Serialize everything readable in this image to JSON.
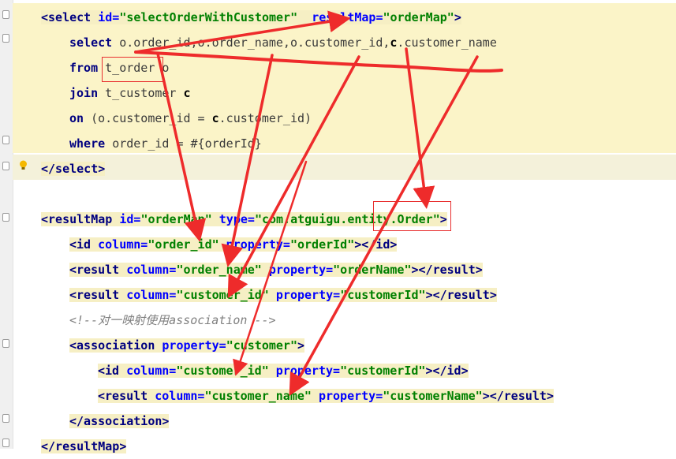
{
  "editor": {
    "line1": {
      "tag_open": "<select ",
      "attr1": "id=",
      "val1": "\"selectOrderWithCustomer\"",
      "sp": "  ",
      "attr2": "resultMap=",
      "val2": "\"orderMap\"",
      "tag_close": ">"
    },
    "line2": {
      "kw": "select ",
      "rest": "o.order_id,o.order_name,o.customer_id,",
      "c": "c",
      "tail": ".customer_name"
    },
    "line3": {
      "kw": "from ",
      "rest": "t_order o"
    },
    "line4": {
      "kw": "join ",
      "rest": "t_customer ",
      "c": "c"
    },
    "line5": {
      "kw": "on ",
      "rest1": "(o.customer_id = ",
      "c": "c",
      "rest2": ".customer_id)"
    },
    "line6": {
      "kw": "where ",
      "rest": "order_id = #{orderId}"
    },
    "line7": {
      "tag": "</select>"
    },
    "line8": {
      "tag_open": "<resultMap ",
      "attr1": "id=",
      "val1": "\"orderMap\"",
      "sp": " ",
      "attr2": "type=",
      "val2": "\"com.atguigu.entity.Order\"",
      "tag_close": ">"
    },
    "line9": {
      "tag_open": "<id ",
      "attr1": "column=",
      "val1": "\"order_id\"",
      "attr2": " property=",
      "val2": "\"orderId\"",
      "tag_close": "></id>"
    },
    "line10": {
      "tag_open": "<result ",
      "attr1": "column=",
      "val1": "\"order_name\"",
      "attr2": " property=",
      "val2": "\"orderName\"",
      "tag_close": "></result>"
    },
    "line11": {
      "tag_open": "<result ",
      "attr1": "column=",
      "val1": "\"customer_id\"",
      "attr2": " property=",
      "val2": "\"customerId\"",
      "tag_close": "></result>"
    },
    "line12": {
      "comment": "<!--对一映射使用association -->"
    },
    "line13": {
      "tag_open": "<association ",
      "attr1": "property=",
      "val1": "\"customer\"",
      "tag_close": ">"
    },
    "line14": {
      "tag_open": "<id ",
      "attr1": "column=",
      "val1": "\"customer_id\"",
      "attr2": " property=",
      "val2": "\"customerId\"",
      "tag_close": "></id>"
    },
    "line15": {
      "tag_open": "<result ",
      "attr1": "column=",
      "val1": "\"customer_name\"",
      "attr2": " property=",
      "val2": "\"customerName\"",
      "tag_close": "></result>"
    },
    "line16": {
      "tag": "</association>"
    },
    "line17": {
      "tag": "</resultMap>"
    }
  },
  "colors": {
    "tag": "#000080",
    "attr": "#0000ff",
    "value": "#008000",
    "comment": "#808080",
    "highlight": "#fbf4c8",
    "annotation": "#ee2b2b"
  },
  "icons": {
    "bulb": "lightbulb-icon",
    "fold": "fold-marker-icon"
  }
}
